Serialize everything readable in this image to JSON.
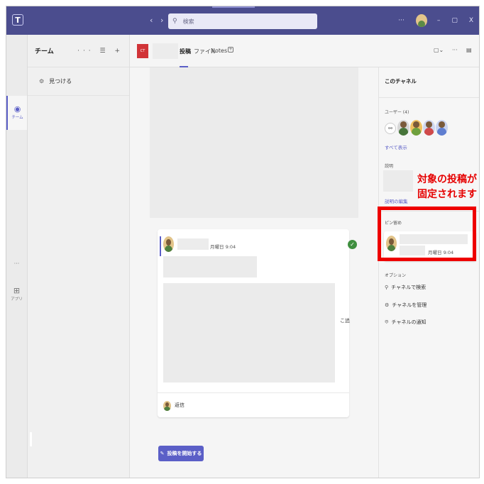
{
  "titlebar": {
    "back": "‹",
    "forward": "›",
    "search_placeholder": "検索",
    "more": "···",
    "minimize": "–",
    "restore": "▢",
    "close": "X"
  },
  "rail": {
    "teams_label": "チーム",
    "more": "···",
    "apps_label": "アプリ"
  },
  "teams_panel": {
    "title": "チーム",
    "actions": "··· ☰ +",
    "find": "見つける"
  },
  "channel": {
    "badge": "CT",
    "tabs": [
      "投稿",
      "ファイル",
      "Notes"
    ]
  },
  "post": {
    "time": "月曜日 9:04",
    "reply": "返信",
    "side_text": "こ追"
  },
  "start_post_button": "投稿を開始する",
  "right_panel": {
    "title": "このチャネル",
    "users_label": "ユーザー (4)",
    "show_all": "すべて表示",
    "description_label": "説明",
    "edit_description": "説明の編集",
    "pinned_label": "ピン留め",
    "pinned_time": "月曜日 9:04",
    "options_label": "オプション",
    "options": [
      "チャネルで検索",
      "チャネルを管理",
      "チャネルの通知"
    ]
  },
  "annotation": {
    "line1": "対象の投稿が",
    "line2": "固定されます"
  },
  "colors": {
    "titlebar": "#4b4d8e",
    "accent": "#5b5fc7",
    "annotation": "#e60000",
    "highlight_border": "#ee0000"
  }
}
